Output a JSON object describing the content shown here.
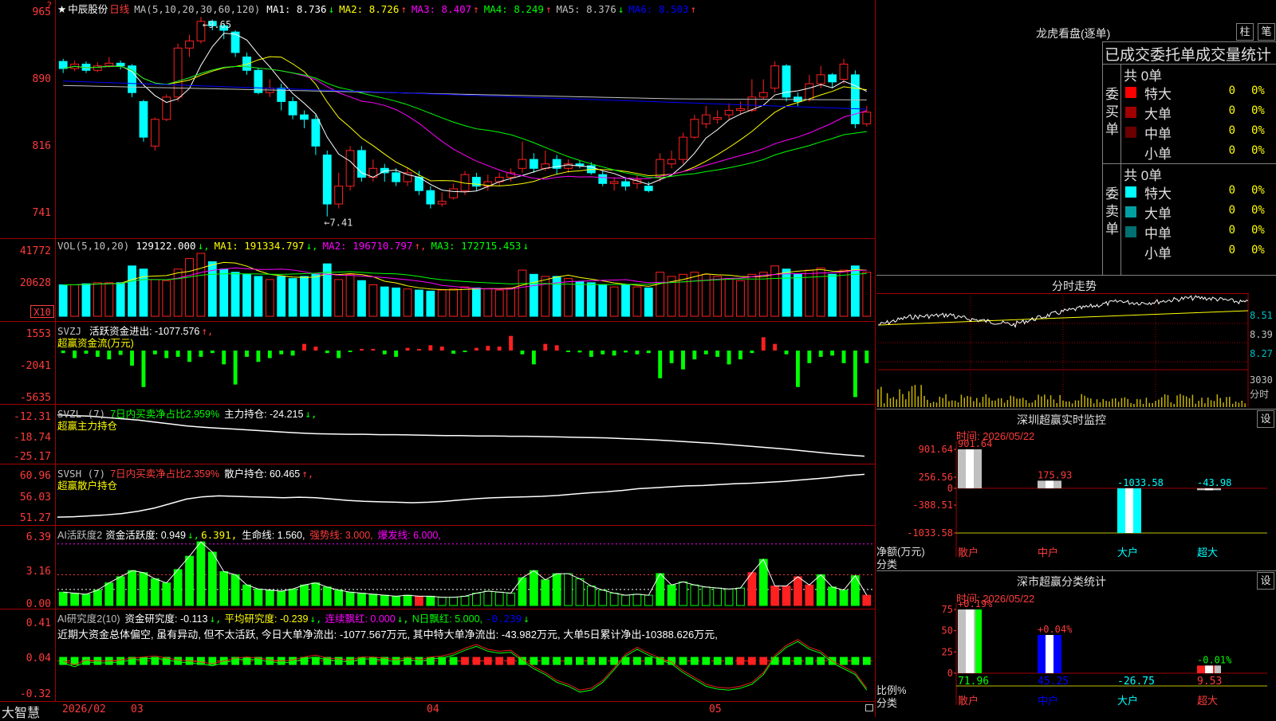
{
  "stock": {
    "name": "中辰股份",
    "period": "日线"
  },
  "main_pane": {
    "indicator": "MA(5,10,20,30,60,120)",
    "ma": [
      {
        "label": "MA1: 8.736",
        "arrow": "↓",
        "color": "#ffffff"
      },
      {
        "label": "MA2: 8.726",
        "arrow": "↑",
        "color": "#ffff00"
      },
      {
        "label": "MA3: 8.407",
        "arrow": "↑",
        "color": "#ff00ff"
      },
      {
        "label": "MA4: 8.249",
        "arrow": "↑",
        "color": "#00ff00"
      },
      {
        "label": "MA5: 8.376",
        "arrow": "↓",
        "color": "#c0c0c0"
      },
      {
        "label": "MA6: 8.503",
        "arrow": "↑",
        "color": "#0000ff"
      }
    ],
    "y_ticks": [
      "965",
      "890",
      "816",
      "741"
    ],
    "high_note": "9.65",
    "low_note": "7.41"
  },
  "vol_pane": {
    "indicator": "VOL(5,10,20)",
    "value": "129122.000",
    "ma1": "MA1: 191334.797",
    "ma2": "MA2: 196710.797",
    "ma3": "MA3: 172715.453",
    "y_ticks": [
      "41772",
      "20628"
    ],
    "unit": "X10"
  },
  "svzj_pane": {
    "title": "SVZJ",
    "item": "活跃资金进出: -1077.576",
    "subtitle": "超赢资金流(万元)",
    "y_ticks": [
      "1553",
      "-2041",
      "-5635"
    ]
  },
  "svzl_pane": {
    "title": "SVZL (7)",
    "ratio": "7日内买卖净占比2.959%",
    "item": "主力持仓: -24.215",
    "subtitle": "超赢主力持仓",
    "y_ticks": [
      "-12.31",
      "-18.74",
      "-25.17"
    ]
  },
  "svsh_pane": {
    "title": "SVSH (7)",
    "ratio": "7日内买卖净占比2.359%",
    "item": "散户持仓: 60.465",
    "subtitle": "超赢散户持仓",
    "y_ticks": [
      "60.96",
      "56.03",
      "51.27"
    ]
  },
  "ai_active_pane": {
    "title": "AI活跃度2",
    "item1": "资金活跃度: 0.949",
    "item2": "6.391,",
    "item3": "生命线: 1.560,",
    "item4": "强势线: 3.000,",
    "item5": "爆发线: 6.000,",
    "y_ticks": [
      "6.39",
      "3.16",
      "0.00"
    ]
  },
  "ai_research_pane": {
    "title": "AI研究度2(10)",
    "item1": "资金研究度: -0.113",
    "item2": "平均研究度: -0.239",
    "item3": "连续飘红: 0.000",
    "item4": "N日飘红: 5.000,",
    "item5": "-0.239",
    "comment": "近期大资金总体偏空, 虽有异动, 但不太活跃, 今日大单净流出: -1077.567万元, 其中特大单净流出: -43.982万元, 大单5日累计净出-10388.626万元,",
    "y_ticks": [
      "0.41",
      "0.04",
      "-0.32"
    ]
  },
  "time_axis": {
    "brand": "大智慧",
    "labels": [
      "2026/02",
      "03",
      "04",
      "05"
    ]
  },
  "dragon_tiger": {
    "title": "龙虎看盘(逐单)",
    "btn1": "柱",
    "btn2": "笔",
    "header": "已成交委托单成交量统计",
    "buy_label": "委买单",
    "sell_label": "委卖单",
    "buy_total": "共 0单",
    "sell_total": "共 0单",
    "buy_rows": [
      {
        "name": "特大",
        "qty": "0",
        "pct": "0%",
        "color": "#ff0000"
      },
      {
        "name": "大单",
        "qty": "0",
        "pct": "0%",
        "color": "#a00000"
      },
      {
        "name": "中单",
        "qty": "0",
        "pct": "0%",
        "color": "#6a0000"
      },
      {
        "name": "小单",
        "qty": "0",
        "pct": "0%",
        "color": "#000000"
      }
    ],
    "sell_rows": [
      {
        "name": "特大",
        "qty": "0",
        "pct": "0%",
        "color": "#00ffff"
      },
      {
        "name": "大单",
        "qty": "0",
        "pct": "0%",
        "color": "#00a0a0"
      },
      {
        "name": "中单",
        "qty": "0",
        "pct": "0%",
        "color": "#007070"
      },
      {
        "name": "小单",
        "qty": "0",
        "pct": "0%",
        "color": "#000000"
      }
    ]
  },
  "intraday": {
    "title": "分时走势",
    "y_ticks": [
      "8.51",
      "8.39",
      "8.27"
    ],
    "vol_tick": "3030",
    "vol_unit": "分时"
  },
  "sz_monitor": {
    "title": "深圳超赢实时监控",
    "btn": "设",
    "time": "时间: 2026/05/22",
    "y_ticks": [
      "901.64",
      "256.56",
      "0",
      "-388.51",
      "-1033.58"
    ],
    "y_unit": "净额(万元)",
    "x_unit": "分类",
    "categories": [
      "散户",
      "中户",
      "大户",
      "超大"
    ],
    "values": [
      901.64,
      175.93,
      -1033.58,
      -43.98
    ],
    "labels": [
      "901.64",
      "175.93",
      "-1033.58",
      "-43.98"
    ]
  },
  "sz_classify": {
    "title": "深市超赢分类统计",
    "btn": "设",
    "time": "时间: 2026/05/22",
    "y_ticks": [
      "75",
      "50",
      "25",
      "0"
    ],
    "y_unit": "比例%",
    "x_unit": "分类",
    "categories": [
      "散户",
      "中户",
      "大户",
      "超大"
    ],
    "bar_values": [
      75,
      45,
      0,
      9
    ],
    "pct_labels": [
      "+0.19%",
      "+0.04%",
      "",
      "-0.01%"
    ],
    "values": [
      "71.96",
      "45.25",
      "-26.75",
      "9.53"
    ]
  },
  "chart_data": {
    "type": "candlestick",
    "ylim": [
      7.3,
      9.75
    ],
    "candles": [
      [
        9.15,
        9.07,
        9.18,
        9.02
      ],
      [
        9.07,
        9.12,
        9.16,
        9.04
      ],
      [
        9.12,
        9.05,
        9.15,
        9.02
      ],
      [
        9.05,
        9.1,
        9.14,
        9.03
      ],
      [
        9.1,
        9.13,
        9.2,
        9.08
      ],
      [
        9.13,
        9.1,
        9.16,
        9.06
      ],
      [
        9.1,
        8.8,
        9.12,
        8.75
      ],
      [
        8.7,
        8.3,
        8.72,
        8.25
      ],
      [
        8.2,
        8.5,
        8.52,
        8.15
      ],
      [
        8.5,
        8.75,
        8.78,
        8.48
      ],
      [
        8.75,
        9.3,
        9.35,
        8.7
      ],
      [
        9.3,
        9.38,
        9.45,
        9.2
      ],
      [
        9.38,
        9.6,
        9.65,
        9.35
      ],
      [
        9.6,
        9.55,
        9.62,
        9.5
      ],
      [
        9.55,
        9.5,
        9.58,
        9.4
      ],
      [
        9.48,
        9.25,
        9.5,
        9.2
      ],
      [
        9.2,
        9.05,
        9.25,
        9.0
      ],
      [
        9.05,
        8.8,
        9.08,
        8.78
      ],
      [
        8.8,
        8.85,
        8.95,
        8.75
      ],
      [
        8.85,
        8.7,
        8.9,
        8.6
      ],
      [
        8.7,
        8.55,
        8.75,
        8.5
      ],
      [
        8.55,
        8.5,
        8.6,
        8.4
      ],
      [
        8.5,
        8.2,
        8.55,
        8.1
      ],
      [
        8.1,
        7.55,
        8.15,
        7.41
      ],
      [
        7.55,
        7.75,
        7.9,
        7.5
      ],
      [
        7.75,
        8.15,
        8.2,
        7.7
      ],
      [
        8.15,
        7.85,
        8.2,
        7.8
      ],
      [
        7.85,
        7.95,
        8.05,
        7.8
      ],
      [
        7.95,
        7.9,
        8.0,
        7.8
      ],
      [
        7.9,
        7.8,
        7.95,
        7.75
      ],
      [
        7.8,
        7.9,
        7.95,
        7.75
      ],
      [
        7.85,
        7.7,
        7.92,
        7.65
      ],
      [
        7.7,
        7.55,
        7.75,
        7.5
      ],
      [
        7.55,
        7.58,
        7.68,
        7.52
      ],
      [
        7.62,
        7.72,
        7.78,
        7.6
      ],
      [
        7.7,
        7.88,
        7.92,
        7.65
      ],
      [
        7.85,
        7.75,
        7.9,
        7.7
      ],
      [
        7.75,
        7.8,
        7.88,
        7.7
      ],
      [
        7.8,
        7.85,
        7.9,
        7.75
      ],
      [
        7.85,
        7.9,
        7.95,
        7.8
      ],
      [
        7.95,
        8.05,
        8.25,
        7.9
      ],
      [
        8.05,
        7.95,
        8.12,
        7.9
      ],
      [
        7.95,
        8.0,
        8.15,
        7.92
      ],
      [
        8.05,
        7.95,
        8.1,
        7.88
      ],
      [
        7.95,
        8.0,
        8.05,
        7.9
      ],
      [
        8.0,
        7.98,
        8.04,
        7.95
      ],
      [
        7.98,
        7.9,
        8.02,
        7.88
      ],
      [
        7.88,
        7.78,
        7.92,
        7.75
      ],
      [
        7.78,
        7.8,
        7.85,
        7.7
      ],
      [
        7.8,
        7.75,
        7.85,
        7.7
      ],
      [
        7.78,
        7.82,
        7.88,
        7.72
      ],
      [
        7.75,
        7.7,
        7.8,
        7.68
      ],
      [
        7.85,
        8.05,
        8.12,
        7.8
      ],
      [
        8.0,
        8.05,
        8.15,
        7.95
      ],
      [
        8.05,
        8.3,
        8.35,
        8.0
      ],
      [
        8.3,
        8.5,
        8.55,
        8.28
      ],
      [
        8.45,
        8.55,
        8.65,
        8.4
      ],
      [
        8.5,
        8.52,
        8.6,
        8.45
      ],
      [
        8.55,
        8.6,
        8.68,
        8.5
      ],
      [
        8.6,
        8.62,
        8.7,
        8.55
      ],
      [
        8.6,
        8.75,
        8.95,
        8.58
      ],
      [
        8.75,
        8.8,
        8.95,
        8.72
      ],
      [
        8.85,
        9.1,
        9.15,
        8.8
      ],
      [
        9.1,
        8.75,
        9.12,
        8.7
      ],
      [
        8.75,
        8.7,
        8.8,
        8.65
      ],
      [
        8.72,
        8.9,
        9.0,
        8.7
      ],
      [
        8.9,
        9.0,
        9.1,
        8.85
      ],
      [
        9.0,
        8.92,
        9.02,
        8.85
      ],
      [
        8.95,
        9.12,
        9.18,
        8.9
      ],
      [
        9.0,
        8.45,
        9.05,
        8.4
      ],
      [
        8.45,
        8.58,
        8.65,
        8.42
      ]
    ],
    "volume": [
      30,
      30,
      31,
      32,
      32,
      32,
      48,
      45,
      35,
      34,
      45,
      55,
      60,
      52,
      45,
      42,
      40,
      38,
      35,
      38,
      36,
      38,
      40,
      50,
      35,
      40,
      34,
      30,
      28,
      27,
      26,
      25,
      24,
      25,
      26,
      28,
      27,
      26,
      25,
      27,
      44,
      40,
      38,
      38,
      36,
      33,
      32,
      30,
      28,
      30,
      28,
      27,
      42,
      38,
      40,
      42,
      40,
      38,
      36,
      34,
      40,
      42,
      48,
      45,
      40,
      44,
      46,
      40,
      44,
      48,
      42
    ],
    "svzj": [
      -200,
      -600,
      -250,
      -500,
      -700,
      -350,
      -1200,
      -2900,
      -300,
      -600,
      -500,
      -900,
      -500,
      -200,
      -1100,
      -2700,
      -500,
      -900,
      -600,
      -300,
      -400,
      500,
      300,
      -200,
      -600,
      -100,
      100,
      100,
      -300,
      -500,
      200,
      100,
      400,
      300,
      -250,
      -50,
      200,
      350,
      300,
      1100,
      -300,
      -1100,
      500,
      400,
      -100,
      -150,
      -500,
      -300,
      -400,
      -150,
      -300,
      -200,
      -2200,
      -1000,
      -1500,
      -700,
      -300,
      -500,
      -1100,
      -700,
      -200,
      1000,
      500,
      -300,
      -2900,
      -1000,
      -500,
      -400,
      -1000,
      -3700,
      -1000
    ],
    "svzl": [
      -12.4,
      -12.6,
      -12.8,
      -13.2,
      -13.6,
      -14.0,
      -14.6,
      -15.2,
      -15.8,
      -16.2,
      -16.5,
      -16.8,
      -17.1,
      -17.4,
      -17.7,
      -18.0,
      -18.2,
      -18.3,
      -18.4,
      -18.4,
      -18.5,
      -18.5,
      -18.6,
      -18.7,
      -18.8,
      -18.8,
      -18.9,
      -18.9,
      -19.0,
      -19.0,
      -19.1,
      -19.2,
      -19.3,
      -19.4,
      -19.5,
      -19.7,
      -19.9,
      -20.1,
      -20.4,
      -20.7,
      -21.0,
      -21.3,
      -21.7,
      -22.1,
      -22.5,
      -22.9,
      -23.4,
      -23.9,
      -24.4,
      -24.8,
      -25.17
    ],
    "svsh": [
      51.5,
      51.6,
      51.8,
      52.0,
      52.3,
      52.8,
      53.5,
      54.5,
      55.5,
      56.0,
      56.2,
      56.1,
      56.0,
      55.9,
      55.8,
      55.9,
      55.8,
      55.5,
      55.2,
      55.0,
      54.9,
      54.8,
      54.7,
      54.8,
      55.0,
      55.3,
      55.6,
      55.8,
      55.9,
      56.0,
      56.1,
      56.3,
      56.6,
      56.9,
      57.1,
      57.4,
      57.8,
      58.0,
      58.2,
      58.4,
      58.5,
      58.7,
      58.9,
      59.0,
      59.2,
      59.4,
      59.7,
      60.0,
      60.3,
      60.7,
      60.96
    ],
    "ai_active": [
      1.3,
      1.2,
      1.1,
      1.5,
      2.2,
      2.8,
      3.4,
      3.2,
      2.6,
      2.2,
      3.5,
      4.8,
      6.2,
      5.2,
      3.3,
      3.0,
      2.0,
      1.6,
      1.5,
      1.4,
      1.6,
      2.0,
      2.2,
      1.8,
      1.5,
      1.3,
      1.2,
      1.1,
      1.0,
      0.9,
      1.0,
      0.9,
      0.9,
      0.8,
      0.8,
      0.9,
      1.2,
      1.4,
      1.3,
      1.2,
      2.7,
      3.4,
      2.5,
      3.1,
      3.1,
      2.6,
      1.9,
      1.5,
      1.2,
      1.0,
      1.1,
      1.0,
      3.1,
      2.0,
      2.3,
      2.0,
      1.8,
      1.7,
      1.6,
      1.7,
      3.2,
      4.5,
      1.9,
      1.9,
      2.8,
      2.0,
      3.0,
      1.8,
      1.5,
      2.9,
      1.0
    ],
    "ai_research": [
      0.02,
      -0.02,
      0.03,
      0.02,
      0.02,
      0.03,
      0.05,
      0.06,
      0.07,
      0.05,
      0.03,
      0.02,
      0.01,
      -0.01,
      0.02,
      0.05,
      0.06,
      0.05,
      0.03,
      0.02,
      0.03,
      0.06,
      0.08,
      0.05,
      0.04,
      0.03,
      0.06,
      0.06,
      0.05,
      0.03,
      0.06,
      0.03,
      0.06,
      0.07,
      0.1,
      0.15,
      0.19,
      0.14,
      0.12,
      0.13,
      0.04,
      -0.04,
      -0.1,
      -0.18,
      -0.22,
      -0.28,
      -0.26,
      -0.18,
      -0.05,
      0.09,
      0.16,
      0.1,
      0.05,
      0.01,
      -0.08,
      -0.15,
      -0.22,
      -0.25,
      -0.26,
      -0.24,
      -0.2,
      -0.1,
      0.08,
      0.18,
      0.24,
      0.16,
      0.12,
      0.02,
      -0.04,
      -0.1,
      -0.26
    ]
  },
  "colors": {
    "up": "#ff2020",
    "down": "#00ffff",
    "grid": "#a00000",
    "axis_text": "#ff3b3b"
  }
}
